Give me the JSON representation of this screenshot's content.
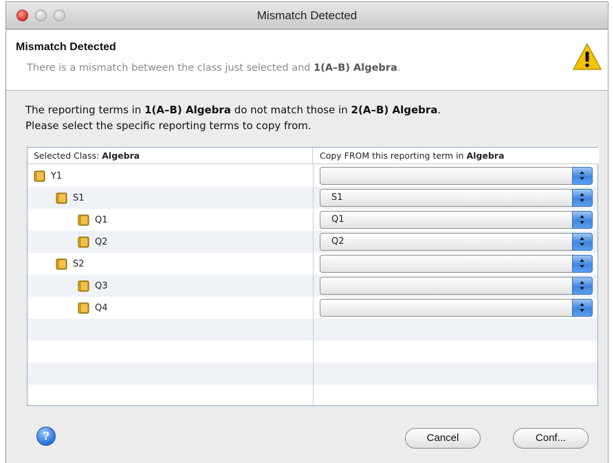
{
  "window": {
    "title": "Mismatch Detected"
  },
  "header": {
    "title": "Mismatch Detected",
    "subtitle_prefix": "There is a mismatch between the class just selected and ",
    "subtitle_class": "1(A–B) Algebra",
    "subtitle_suffix": "."
  },
  "message": {
    "line1_part1": "The reporting terms in ",
    "line1_class1": "1(A–B) Algebra",
    "line1_part2": " do not match those in ",
    "line1_class2": "2(A–B) Algebra",
    "line1_part3": ".",
    "line2": "Please select the specific reporting terms to copy from."
  },
  "table": {
    "left_header_prefix": "Selected Class: ",
    "left_header_class": "Algebra",
    "right_header_prefix": "Copy FROM this reporting term in ",
    "right_header_class": "Algebra",
    "rows": [
      {
        "term": "Y1",
        "selected": ""
      },
      {
        "term": "S1",
        "selected": "S1"
      },
      {
        "term": "Q1",
        "selected": "Q1"
      },
      {
        "term": "Q2",
        "selected": "Q2"
      },
      {
        "term": "S2",
        "selected": ""
      },
      {
        "term": "Q3",
        "selected": ""
      },
      {
        "term": "Q4",
        "selected": ""
      }
    ]
  },
  "buttons": {
    "help": "?",
    "cancel": "Cancel",
    "confirm": "Conf..."
  },
  "icons": {
    "warning": "warning-icon",
    "folder": "folder-icon",
    "help": "help-icon"
  },
  "colors": {
    "popup_accent": "#3f86e0",
    "warning": "#f5c400",
    "folder": "#d9a21a"
  }
}
